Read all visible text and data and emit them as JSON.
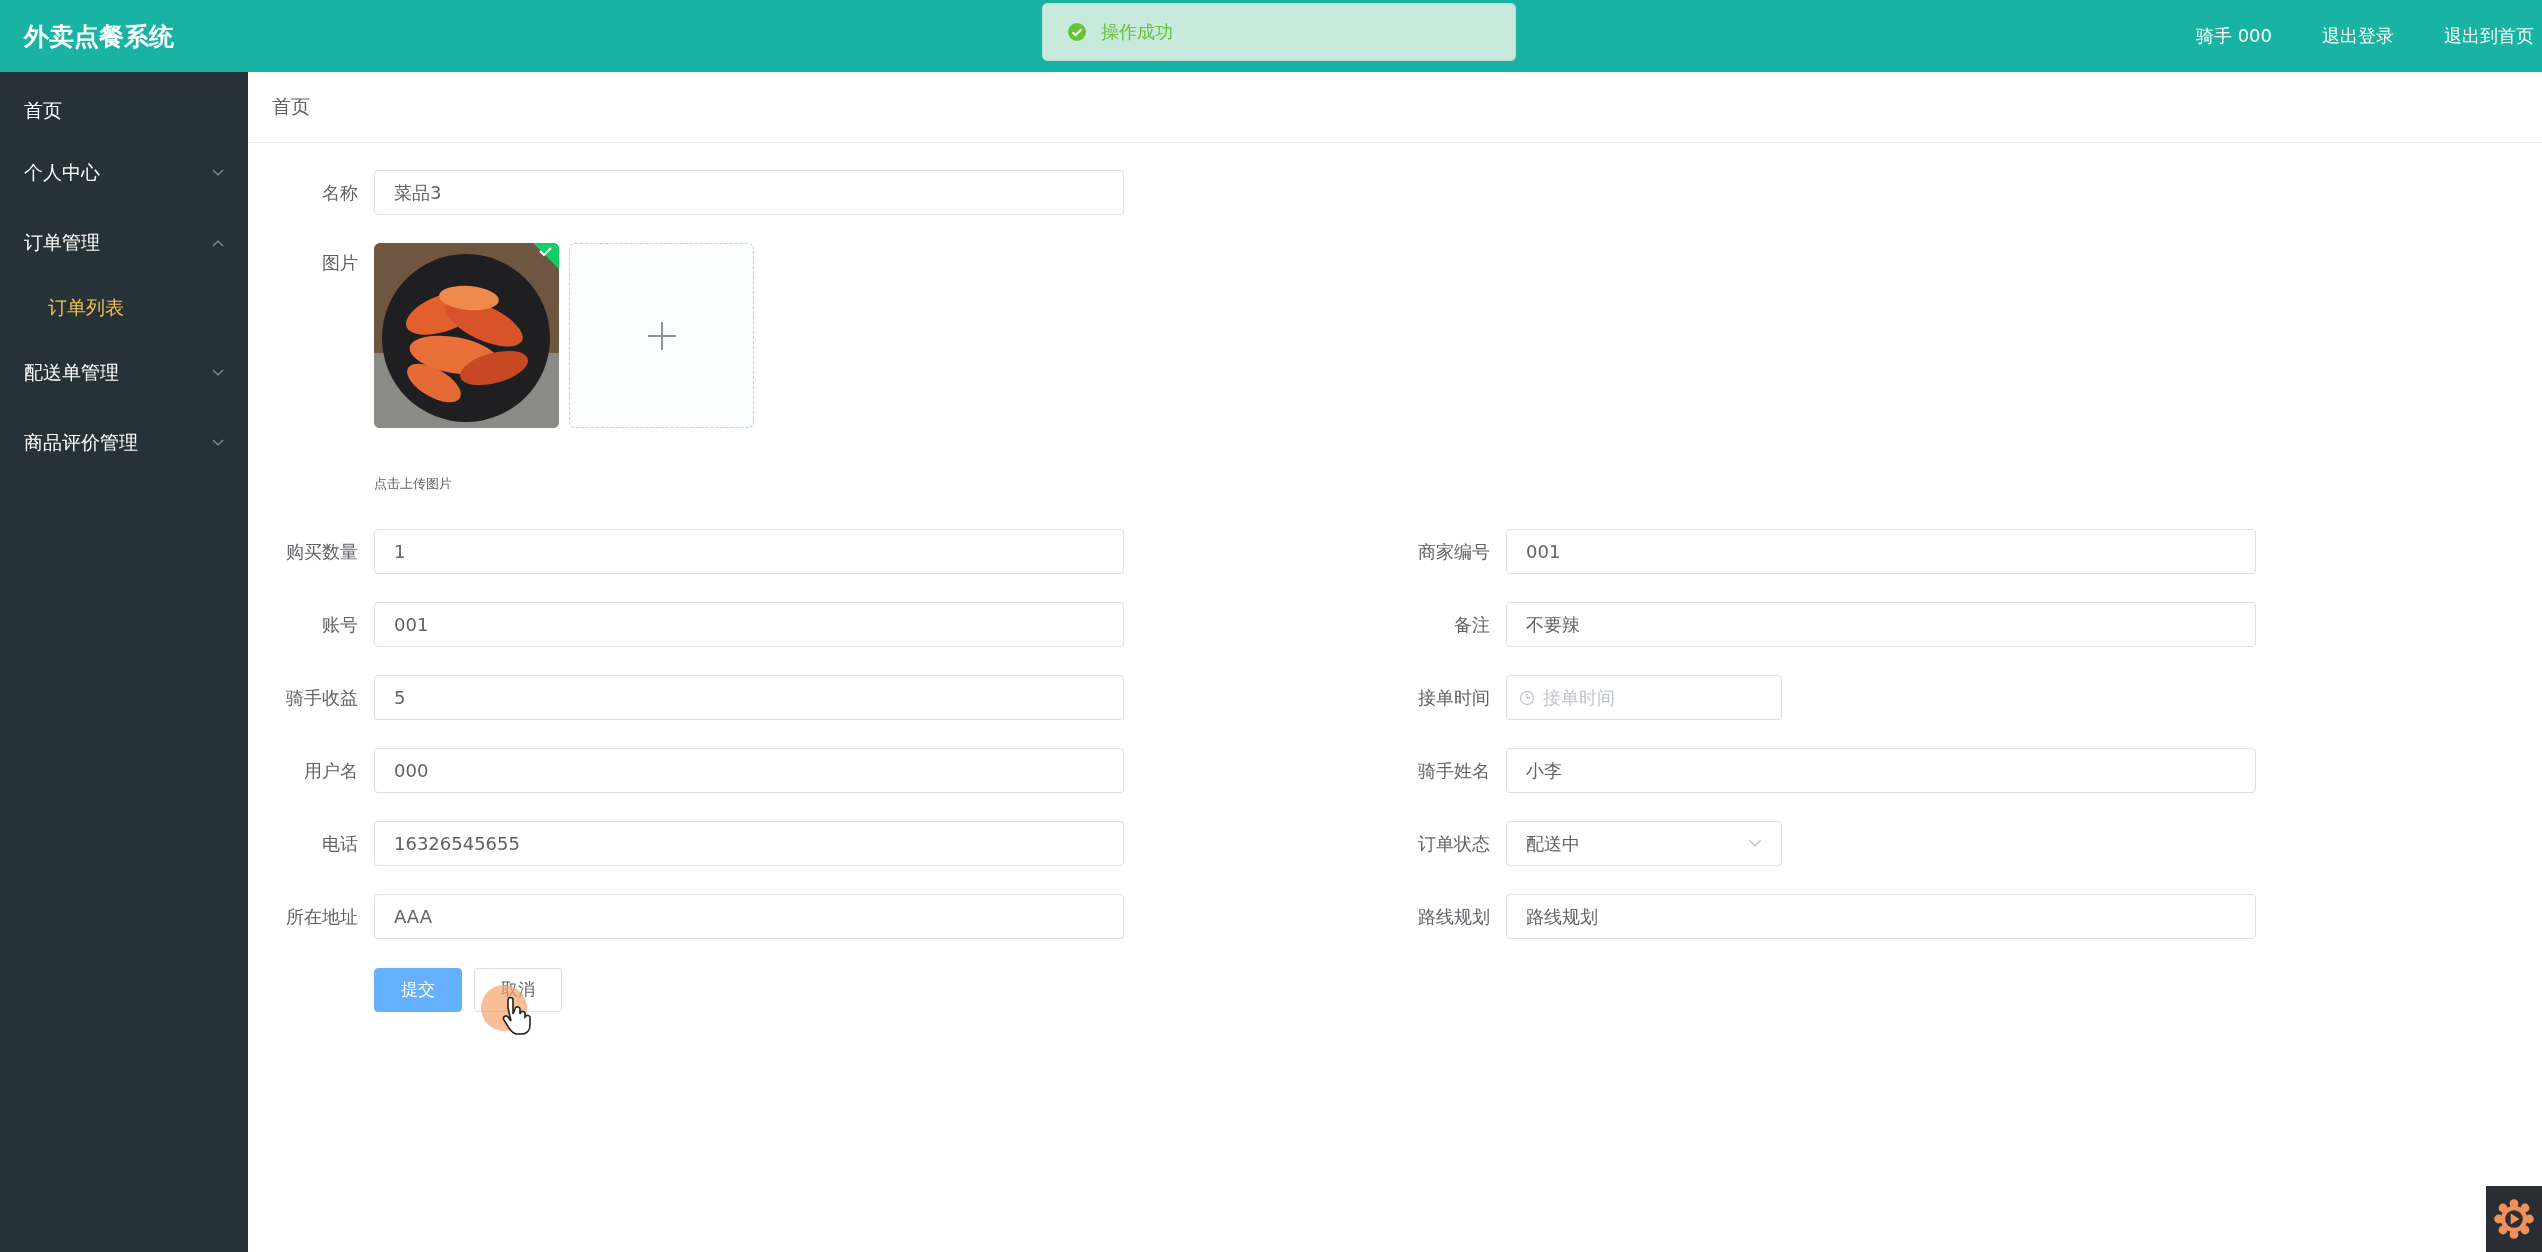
{
  "header": {
    "title": "外卖点餐系统",
    "links": [
      "骑手 000",
      "退出登录",
      "退出到首页"
    ]
  },
  "toast": {
    "message": "操作成功"
  },
  "sidebar": {
    "items": [
      {
        "label": "首页"
      },
      {
        "label": "个人中心",
        "expanded": false
      },
      {
        "label": "订单管理",
        "expanded": true,
        "children": [
          {
            "label": "订单列表",
            "selected": true
          }
        ]
      },
      {
        "label": "配送单管理",
        "expanded": false
      },
      {
        "label": "商品评价管理",
        "expanded": false
      }
    ]
  },
  "breadcrumb": "首页",
  "name_field": {
    "label": "名称",
    "value": "菜品3"
  },
  "image_upload": {
    "label": "图片",
    "uploaded": true,
    "hint": "点击上传图片"
  },
  "fields": [
    {
      "kind": "text",
      "label": "购买数量",
      "value": "1"
    },
    {
      "kind": "text",
      "label": "商家编号",
      "value": "001"
    },
    {
      "kind": "text",
      "label": "账号",
      "value": "001"
    },
    {
      "kind": "text",
      "label": "备注",
      "value": "不要辣"
    },
    {
      "kind": "text",
      "label": "骑手收益",
      "value": "5"
    },
    {
      "kind": "time",
      "label": "接单时间",
      "placeholder": "接单时间"
    },
    {
      "kind": "text",
      "label": "用户名",
      "value": "000"
    },
    {
      "kind": "text",
      "label": "骑手姓名",
      "value": "小李"
    },
    {
      "kind": "text",
      "label": "电话",
      "value": "16326545655"
    },
    {
      "kind": "select",
      "label": "订单状态",
      "value": "配送中"
    },
    {
      "kind": "text",
      "label": "所在地址",
      "value": "AAA"
    },
    {
      "kind": "text",
      "label": "路线规划",
      "value": "路线规划"
    }
  ],
  "buttons": [
    {
      "kind": "primary",
      "label": "提交"
    },
    {
      "kind": "default",
      "label": "取消"
    }
  ]
}
